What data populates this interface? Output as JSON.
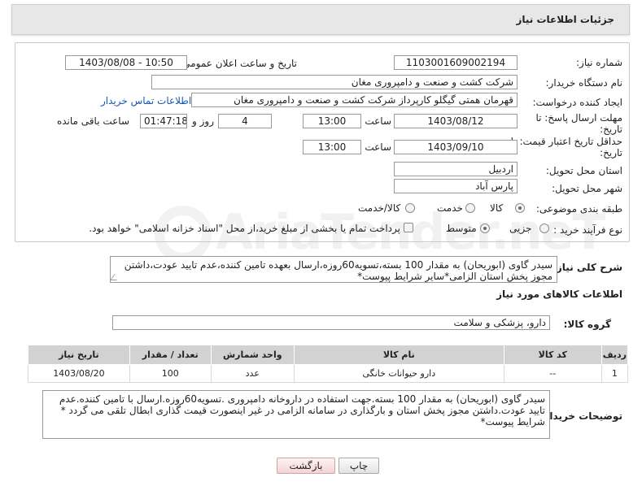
{
  "header": {
    "title": "جزئیات اطلاعات نیاز"
  },
  "watermark": {
    "text": "AriaTender.neT"
  },
  "form": {
    "need_number_label": "شماره نیاز:",
    "need_number": "1103001609002194",
    "announce_label": "تاریخ و ساعت اعلان عمومی:",
    "announce_value": "1403/08/08 - 10:50",
    "buyer_org_label": "نام دستگاه خریدار:",
    "buyer_org": "شرکت کشت و صنعت و دامپروری مغان",
    "requester_label": "ایجاد کننده درخواست:",
    "requester": "قهرمان همتی گیگلو کارپرداز شرکت کشت و صنعت و دامپروری مغان",
    "contact_link": "اطلاعات تماس خریدار",
    "reply_deadline_label_1": "مهلت ارسال پاسخ: تا",
    "reply_deadline_label_2": "تاریخ:",
    "reply_date": "1403/08/12",
    "time_label": "ساعت",
    "reply_time": "13:00",
    "days_value": "4",
    "days_and_label": "روز و",
    "remaining_time": "01:47:18",
    "remaining_label": "ساعت باقی مانده",
    "validity_label_1": "حداقل تاریخ اعتبار قیمت: تا",
    "validity_label_2": "تاریخ:",
    "validity_date": "1403/09/10",
    "validity_time": "13:00",
    "province_label": "استان محل تحویل:",
    "province": "اردبیل",
    "city_label": "شهر محل تحویل:",
    "city": "پارس آباد",
    "category_label": "طبقه بندی موضوعی:",
    "category_options": [
      "کالا",
      "خدمت",
      "کالا/خدمت"
    ],
    "purchase_type_label": "نوع فرآیند خرید :",
    "purchase_options": [
      "جزیی",
      "متوسط"
    ],
    "payment_note": "پرداخت تمام یا بخشی از مبلغ خرید،از محل \"اسناد خزانه اسلامی\" خواهد بود."
  },
  "description": {
    "label": "شرح کلی نیاز:",
    "text": "سیدر گاوی (ابوریحان) به مقدار 100 بسته،تسویه60روزه،ارسال بعهده تامین کننده،عدم تایید عودت،داشتن مجوز پخش استان الزامی*سایر شرایط پیوست*"
  },
  "goods": {
    "section_title": "اطلاعات کالاهای مورد نیاز",
    "group_label": "گروه کالا:",
    "group_value": "دارو، پزشکی و سلامت",
    "columns": [
      "ردیف",
      "کد کالا",
      "نام کالا",
      "واحد شمارش",
      "تعداد / مقدار",
      "تاریخ نیاز"
    ],
    "rows": [
      {
        "row": "1",
        "code": "--",
        "name": "دارو حیوانات خانگی",
        "unit": "عدد",
        "qty": "100",
        "date": "1403/08/20"
      }
    ]
  },
  "buyer_notes": {
    "label": "توضیحات خریدار:",
    "text": "سیدر گاوی (ابوریحان) به مقدار 100 بسته.جهت استفاده در داروخانه دامپروری .تسویه60روزه.ارسال با تامین کننده.عدم تایید عودت.داشتن مجوز پخش استان و بارگذاری در سامانه الزامی در غیر اینصورت قیمت گذاری ابطال تلقی می گردد * شرایط پیوست*"
  },
  "buttons": {
    "print": "چاپ",
    "back": "بازگشت"
  }
}
